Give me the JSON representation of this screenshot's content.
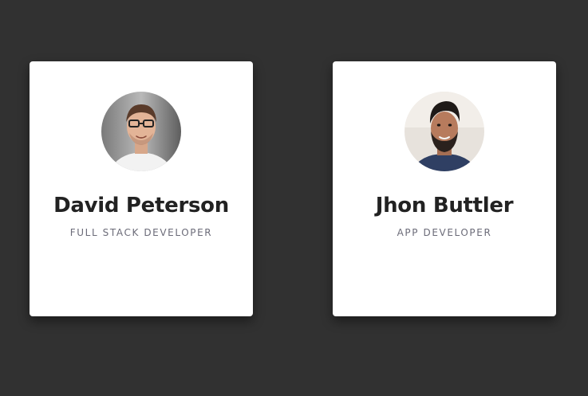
{
  "background_color": "#313131",
  "cards": [
    {
      "name": "David Peterson",
      "role": "FULL STACK DEVELOPER",
      "avatar_icon": "avatar-david-peterson"
    },
    {
      "name": "Jhon Buttler",
      "role": "APP DEVELOPER",
      "avatar_icon": "avatar-jhon-buttler"
    }
  ]
}
